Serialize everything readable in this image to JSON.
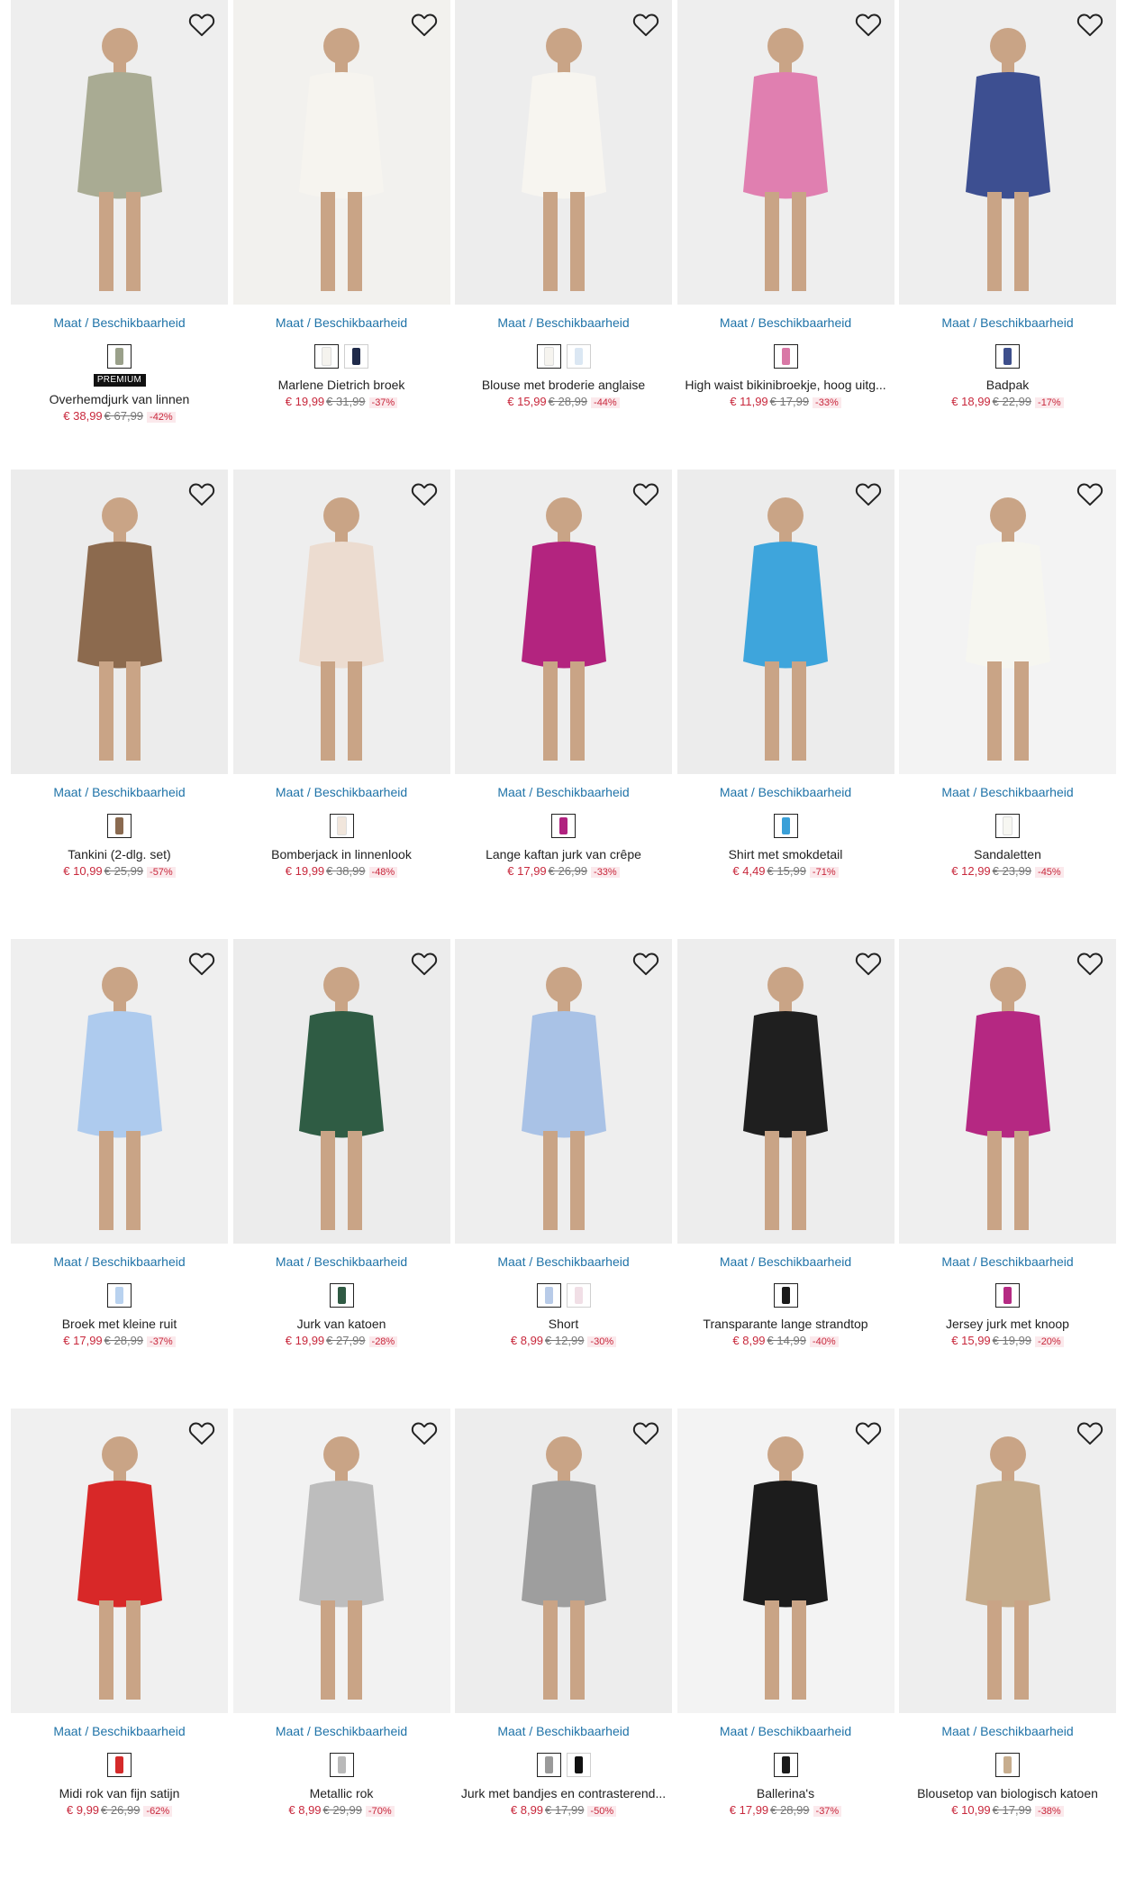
{
  "size_link_label": "Maat / Beschikbaarheid",
  "products": [
    {
      "title": "Overhemdjurk van linnen",
      "badge": "PREMIUM",
      "price": "€ 38,99",
      "old_price": "€ 67,99",
      "discount": "-42%",
      "swatches": [
        "#9aa08a"
      ],
      "photo_bg": "#eeeeee",
      "garment": "#a9ab93"
    },
    {
      "title": "Marlene Dietrich broek",
      "price": "€ 19,99",
      "old_price": "€ 31,99",
      "discount": "-37%",
      "swatches": [
        "#f5f3ee",
        "#1f2a4a"
      ],
      "photo_bg": "#f2f1ee",
      "garment": "#f6f4ef"
    },
    {
      "title": "Blouse met broderie anglaise",
      "price": "€ 15,99",
      "old_price": "€ 28,99",
      "discount": "-44%",
      "swatches": [
        "#f6f4ef",
        "#dbe7f3"
      ],
      "photo_bg": "#ededed",
      "garment": "#f7f5f0"
    },
    {
      "title": "High waist bikinibroekje, hoog uitg...",
      "price": "€ 11,99",
      "old_price": "€ 17,99",
      "discount": "-33%",
      "swatches": [
        "#d978a6"
      ],
      "photo_bg": "#eeeeee",
      "garment": "#e07fb0"
    },
    {
      "title": "Badpak",
      "price": "€ 18,99",
      "old_price": "€ 22,99",
      "discount": "-17%",
      "swatches": [
        "#3e4f8c"
      ],
      "photo_bg": "#eeeeee",
      "garment": "#3d4f91"
    },
    {
      "title": "Tankini (2-dlg. set)",
      "price": "€ 10,99",
      "old_price": "€ 25,99",
      "discount": "-57%",
      "swatches": [
        "#8a6a50"
      ],
      "photo_bg": "#ececec",
      "garment": "#8c6a4e"
    },
    {
      "title": "Bomberjack in linnenlook",
      "price": "€ 19,99",
      "old_price": "€ 38,99",
      "discount": "-48%",
      "swatches": [
        "#f1e6dc"
      ],
      "photo_bg": "#eeeeee",
      "garment": "#ecdcd0"
    },
    {
      "title": "Lange kaftan jurk van crêpe",
      "price": "€ 17,99",
      "old_price": "€ 26,99",
      "discount": "-33%",
      "swatches": [
        "#b0227f"
      ],
      "photo_bg": "#eeeeee",
      "garment": "#b3247f"
    },
    {
      "title": "Shirt met smokdetail",
      "price": "€ 4,49",
      "old_price": "€ 15,99",
      "discount": "-71%",
      "swatches": [
        "#3aa0d8"
      ],
      "photo_bg": "#ececec",
      "garment": "#3ea5dc"
    },
    {
      "title": "Sandaletten",
      "price": "€ 12,99",
      "old_price": "€ 23,99",
      "discount": "-45%",
      "swatches": [
        "#f7f7f2"
      ],
      "photo_bg": "#f3f3f3",
      "garment": "#f6f6f0"
    },
    {
      "title": "Broek met kleine ruit",
      "price": "€ 17,99",
      "old_price": "€ 28,99",
      "discount": "-37%",
      "swatches": [
        "#b9d2ef"
      ],
      "photo_bg": "#efefef",
      "garment": "#aecbee"
    },
    {
      "title": "Jurk van katoen",
      "price": "€ 19,99",
      "old_price": "€ 27,99",
      "discount": "-28%",
      "swatches": [
        "#2f5a43"
      ],
      "photo_bg": "#ececec",
      "garment": "#2f5c44"
    },
    {
      "title": "Short",
      "price": "€ 8,99",
      "old_price": "€ 12,99",
      "discount": "-30%",
      "swatches": [
        "#b8cbe8",
        "#f1dfe6"
      ],
      "photo_bg": "#eeeeee",
      "garment": "#a9c2e6"
    },
    {
      "title": "Transparante lange strandtop",
      "price": "€ 8,99",
      "old_price": "€ 14,99",
      "discount": "-40%",
      "swatches": [
        "#1a1a1a"
      ],
      "photo_bg": "#ededed",
      "garment": "#1f1f1f"
    },
    {
      "title": "Jersey jurk met knoop",
      "price": "€ 15,99",
      "old_price": "€ 19,99",
      "discount": "-20%",
      "swatches": [
        "#b52a83"
      ],
      "photo_bg": "#efefef",
      "garment": "#b52882"
    },
    {
      "title": "Midi rok van fijn satijn",
      "price": "€ 9,99",
      "old_price": "€ 26,99",
      "discount": "-62%",
      "swatches": [
        "#d52a2a"
      ],
      "photo_bg": "#f0f0f0",
      "garment": "#d82828"
    },
    {
      "title": "Metallic rok",
      "price": "€ 8,99",
      "old_price": "€ 29,99",
      "discount": "-70%",
      "swatches": [
        "#b9b9b9"
      ],
      "photo_bg": "#f2f2f2",
      "garment": "#bdbdbd"
    },
    {
      "title": "Jurk met bandjes en contrasterend...",
      "price": "€ 8,99",
      "old_price": "€ 17,99",
      "discount": "-50%",
      "swatches": [
        "#9a9a9a",
        "#111111"
      ],
      "photo_bg": "#ededed",
      "garment": "#9e9e9e"
    },
    {
      "title": "Ballerina's",
      "price": "€ 17,99",
      "old_price": "€ 28,99",
      "discount": "-37%",
      "swatches": [
        "#1a1a1a"
      ],
      "photo_bg": "#f3f3f3",
      "garment": "#1c1c1c"
    },
    {
      "title": "Blousetop van biologisch katoen",
      "price": "€ 10,99",
      "old_price": "€ 17,99",
      "discount": "-38%",
      "swatches": [
        "#c7ad8e"
      ],
      "photo_bg": "#eeeeee",
      "garment": "#c5ab8b"
    }
  ]
}
